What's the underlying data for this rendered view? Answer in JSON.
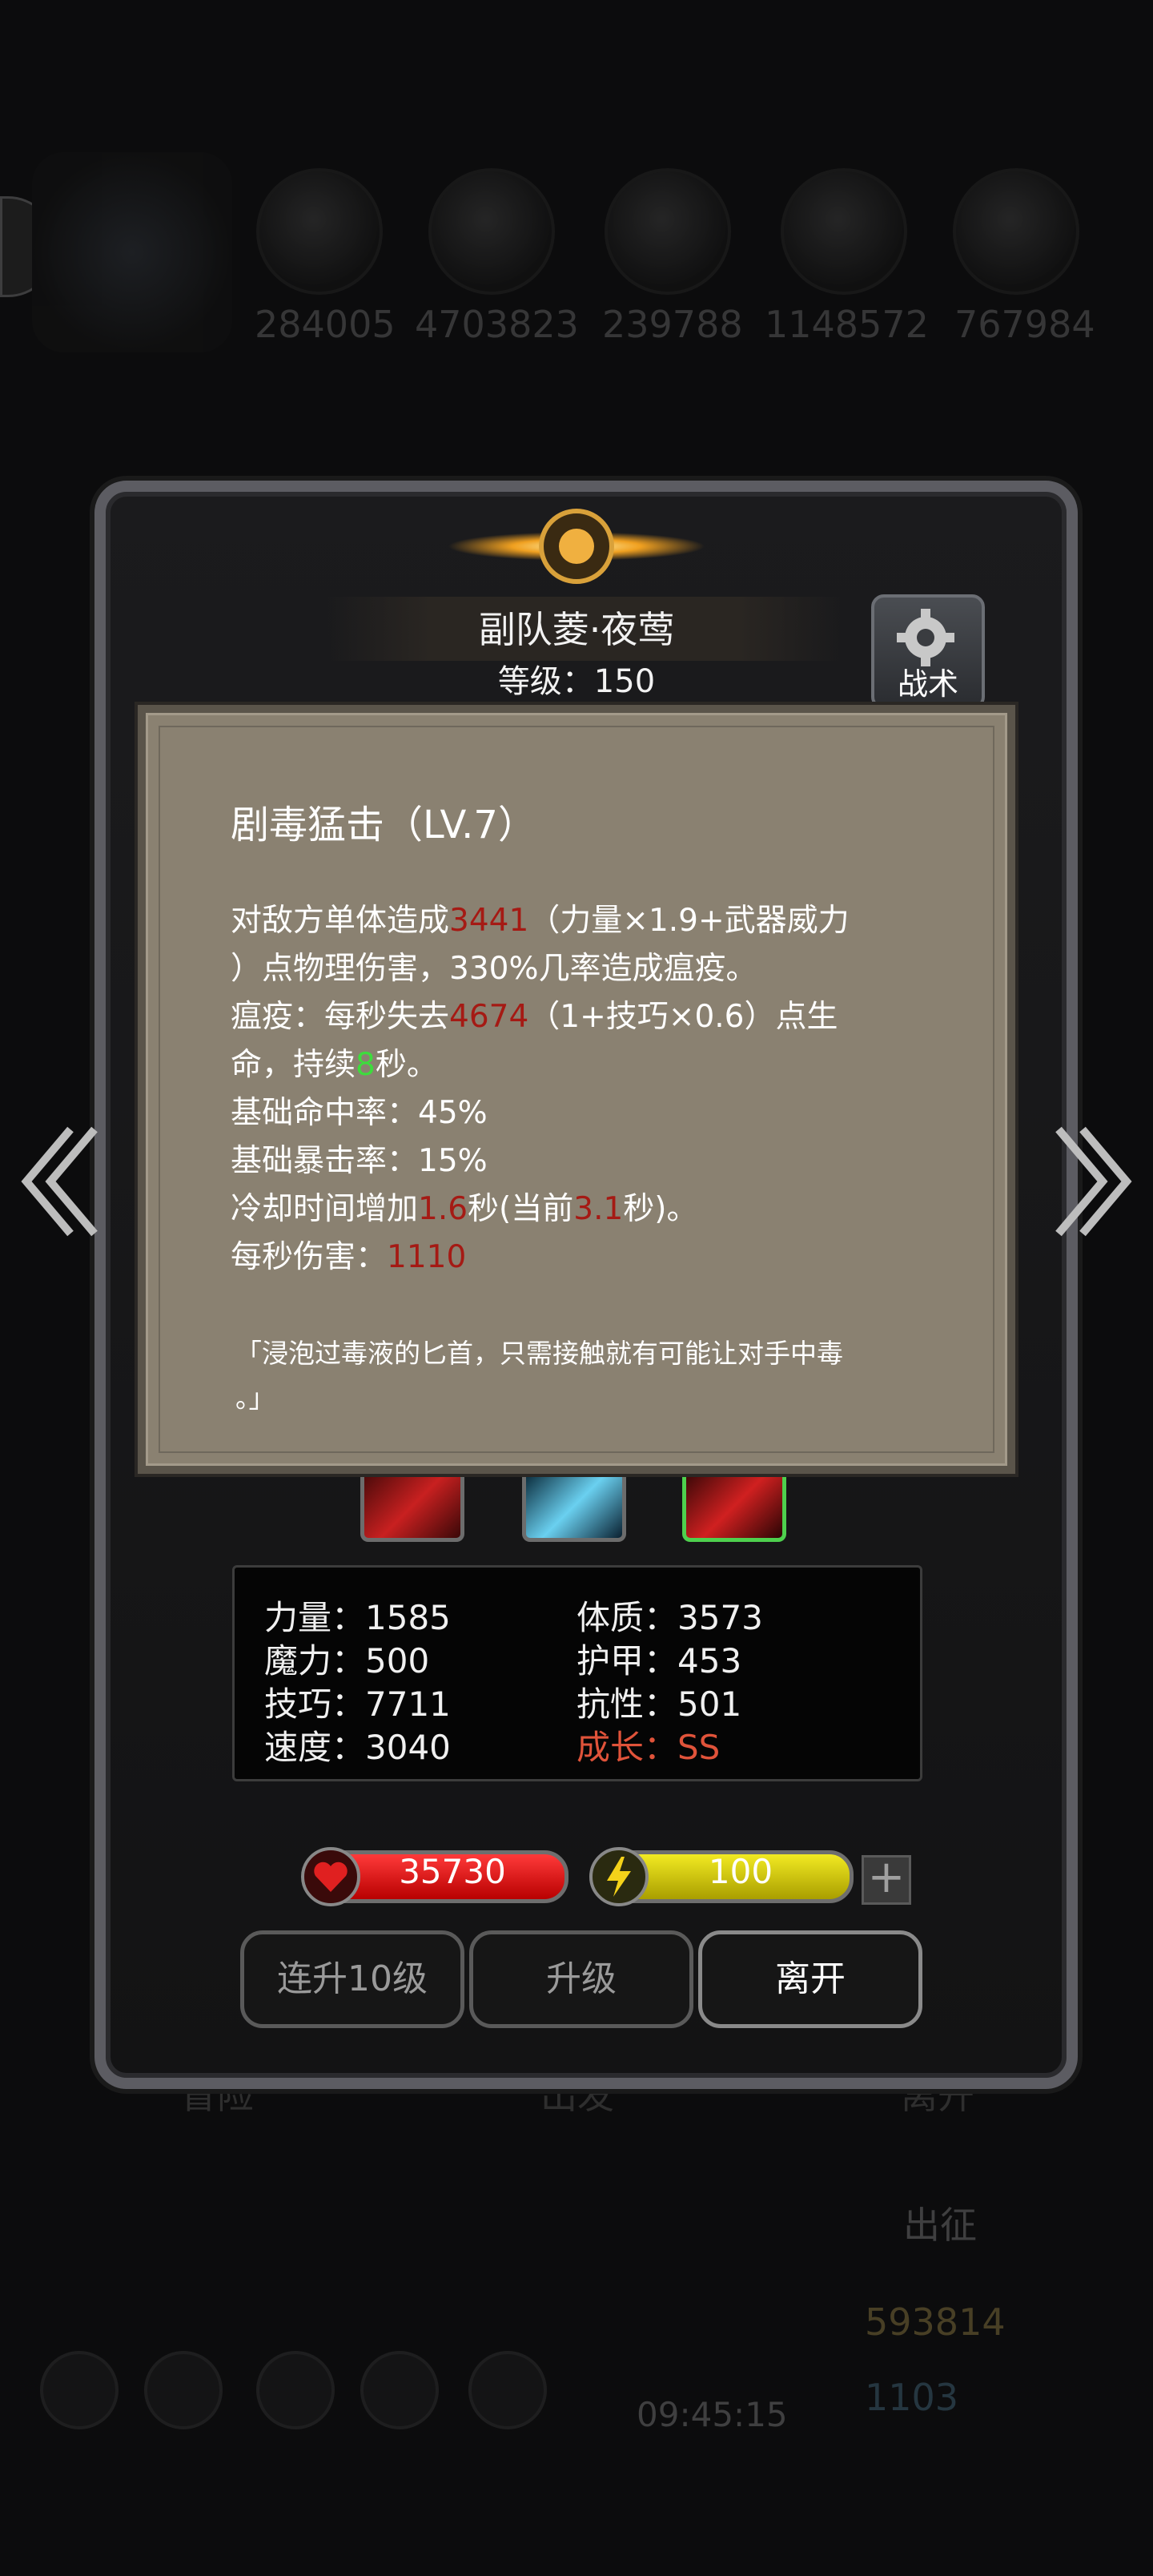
{
  "background": {
    "resources": [
      "284005",
      "4703823",
      "239788",
      "1148572",
      "767984"
    ],
    "bottom_labels": [
      "冒险",
      "出发",
      "离开"
    ],
    "expedition_label": "出征",
    "gold": "593814",
    "gems": "1103",
    "clock": "09:45:15"
  },
  "hero": {
    "name": "副队菱·夜莺",
    "level": "等级：150",
    "tactics_label": "战术"
  },
  "skill_tooltip": {
    "title": "剧毒猛击（LV.7）",
    "line1_a": "对敌方单体造成",
    "line1_dmg": "3441",
    "line1_b": "（力量×1.9+武器威力",
    "line2": "）点物理伤害，330%几率造成瘟疫。",
    "line3_a": "瘟疫：每秒失去",
    "line3_dmg": "4674",
    "line3_b": "（1+技巧×0.6）点生",
    "line4_a": "命，持续",
    "line4_dur": "8",
    "line4_b": "秒。",
    "hit_rate": "基础命中率：45%",
    "crit_rate": "基础暴击率：15%",
    "cd_a": "冷却时间增加",
    "cd_inc": "1.6",
    "cd_b": "秒(当前",
    "cd_cur": "3.1",
    "cd_c": "秒)。",
    "dps_a": "每秒伤害：",
    "dps_val": "1110",
    "quote_line1": "「浸泡过毒液的匕首，只需接触就有可能让对手中毒",
    "quote_line2": "。」"
  },
  "stats": {
    "strength": "力量：1585",
    "magic": "魔力：500",
    "skill": "技巧：7711",
    "speed": "速度：3040",
    "constitution": "体质：3573",
    "armor": "护甲：453",
    "resistance": "抗性：501",
    "growth": "成长：SS"
  },
  "resources": {
    "hp": "35730",
    "energy": "100",
    "plus": "+"
  },
  "buttons": {
    "upgrade10": "连升10级",
    "upgrade": "升级",
    "leave": "离开"
  },
  "colors": {
    "damage_red": "#a51a14",
    "duration_green": "#3ddc3d",
    "growth_orange": "#e0533a",
    "tooltip_bg": "#8a8171"
  }
}
